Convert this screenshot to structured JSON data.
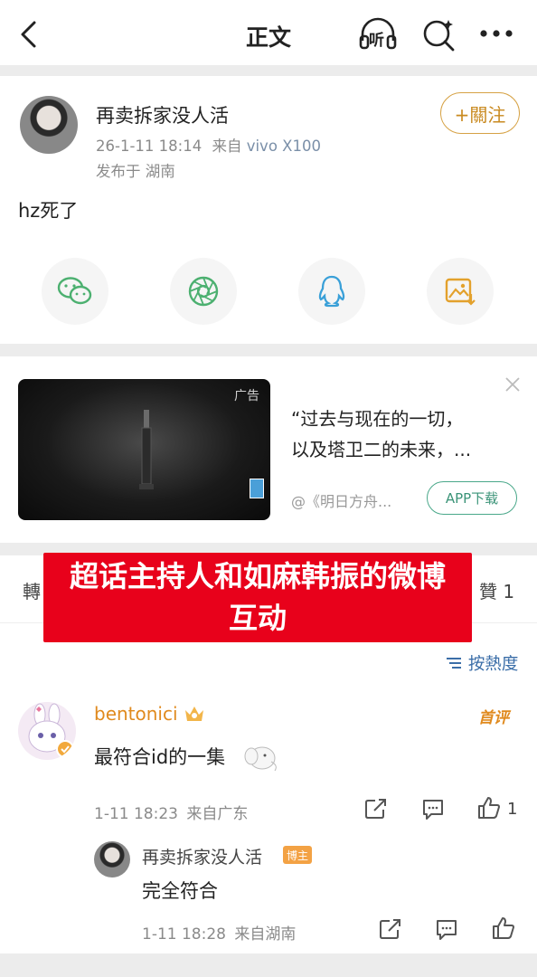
{
  "nav": {
    "title": "正文",
    "listen_label": "听"
  },
  "post": {
    "author": "再卖拆家没人活",
    "time": "26-1-11 18:14",
    "source_prefix": "来自",
    "device": "vivo X100",
    "location": "发布于 湖南",
    "follow_label": "+關注",
    "content": "hz死了"
  },
  "ad": {
    "tag": "广告",
    "text_line1": "“过去与现在的一切，",
    "text_line2": "以及塔卫二的未来，...",
    "source": "@《明日方舟...",
    "button": "APP下载"
  },
  "tabs": {
    "left": "轉",
    "right": "贊 1"
  },
  "overlay": {
    "line1": "超话主持人和如麻韩振的微博",
    "line2": "互动"
  },
  "sort": {
    "label": "按熱度"
  },
  "comment": {
    "name": "bentonici",
    "badge": "首评",
    "text": "最符合id的一集",
    "time": "1-11 18:23",
    "location": "来自广东",
    "likes": "1"
  },
  "reply": {
    "name": "再卖拆家没人活",
    "badge": "博主",
    "text": "完全符合",
    "time": "1-11 18:28",
    "location": "来自湖南"
  }
}
